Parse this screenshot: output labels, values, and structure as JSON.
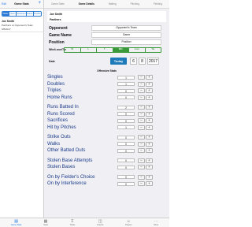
{
  "left_panel": {
    "edit_label": "Edit",
    "title": "Game Stats",
    "add_symbol": "+",
    "filters": [
      {
        "label": "Dates",
        "selected": true
      },
      {
        "label": "Team",
        "selected": false
      },
      {
        "label": "Opponent",
        "selected": false
      },
      {
        "label": "Game",
        "selected": false
      },
      {
        "label": "Position",
        "selected": false
      }
    ],
    "games": [
      {
        "player": "Joe Smith",
        "detail": "Panthers vs Opponent's Team",
        "date": "6/8/2017"
      }
    ]
  },
  "right_panel": {
    "nav_items": [
      "Game Stats",
      "Game Details",
      "Batting",
      "Pitching",
      "Fielding"
    ],
    "nav_title_index": 1,
    "player_name": "Joe Smith",
    "team_name": "Panthers",
    "fields": [
      {
        "label": "Opponent",
        "value": "Opponent's Team"
      },
      {
        "label": "Game Name",
        "value": "Game"
      },
      {
        "label": "Position",
        "value": "Position"
      }
    ],
    "wlt_label": "Win/Lose/Tie",
    "wlt_options": [
      "W",
      "L",
      "T",
      "Win",
      "Lose",
      "Tie"
    ],
    "wlt_selected_index": 3,
    "date_label": "Date",
    "today_label": "Today",
    "date": {
      "month": "6",
      "day": "8",
      "year": "2017"
    },
    "section_title": "Offensive Stats",
    "minus_symbol": "−",
    "plus_symbol": "+",
    "stat_groups": [
      [
        {
          "label": "Singles",
          "value": "1"
        },
        {
          "label": "Doubles",
          "value": "1"
        },
        {
          "label": "Triples",
          "value": "0"
        },
        {
          "label": "Home Runs",
          "value": "0"
        }
      ],
      [
        {
          "label": "Runs Batted In",
          "value": "2"
        },
        {
          "label": "Runs Scored",
          "value": "0"
        },
        {
          "label": "Sacrifices",
          "value": "0"
        },
        {
          "label": "Hit by Pitches",
          "value": "1"
        }
      ],
      [
        {
          "label": "Strike Outs",
          "value": "0"
        },
        {
          "label": "Walks",
          "value": "0"
        },
        {
          "label": "Other Batted Outs",
          "value": "0"
        }
      ],
      [
        {
          "label": "Stolen Base Attempts",
          "value": "0"
        },
        {
          "label": "Stolen Bases",
          "value": "0"
        }
      ],
      [
        {
          "label": "On by Fielder's Choice",
          "value": "0"
        },
        {
          "label": "On by Interference",
          "value": "0"
        }
      ]
    ]
  },
  "tabbar": {
    "tabs": [
      {
        "label": "Game Stats",
        "icon": "chart-icon",
        "glyph": "▤",
        "selected": true
      },
      {
        "label": "Stats",
        "icon": "table-icon",
        "glyph": "▦",
        "selected": false
      },
      {
        "label": "Totals",
        "icon": "sum-icon",
        "glyph": "Σ",
        "selected": false
      },
      {
        "label": "Graphs",
        "icon": "graph-icon",
        "glyph": "◫",
        "selected": false
      },
      {
        "label": "Players",
        "icon": "people-icon",
        "glyph": "☺",
        "selected": false
      },
      {
        "label": "More",
        "icon": "more-icon",
        "glyph": "⋯",
        "selected": false
      }
    ]
  }
}
